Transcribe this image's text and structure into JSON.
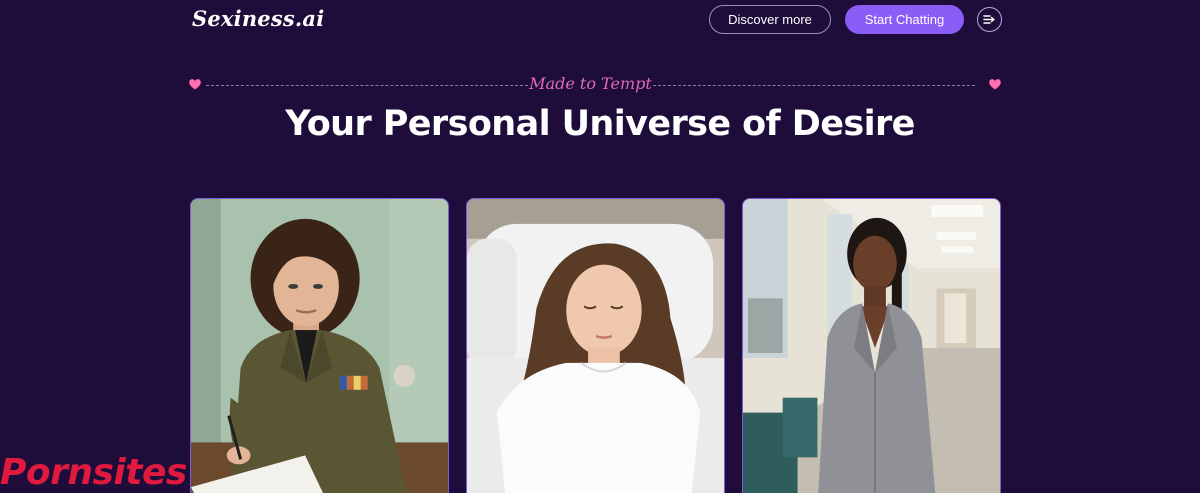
{
  "header": {
    "logo_text": "Sexiness.ai",
    "discover_label": "Discover more",
    "chat_label": "Start Chatting",
    "menu_icon": "menu-arrow-icon"
  },
  "hero": {
    "tagline": "Made to Tempt",
    "title": "Your Personal Universe of Desire"
  },
  "cards": [
    {
      "image": "woman in olive military uniform writing in a notebook"
    },
    {
      "image": "woman in white t-shirt sleeping on white pillows"
    },
    {
      "image": "woman in grey blazer standing in a hospital hallway"
    }
  ],
  "watermark": "Pornsites",
  "colors": {
    "background": "#1e0d3a",
    "accent": "#8b5cf6",
    "tagline": "#e06ab3",
    "heart": "#ff6fb1",
    "watermark": "#e0193e"
  }
}
